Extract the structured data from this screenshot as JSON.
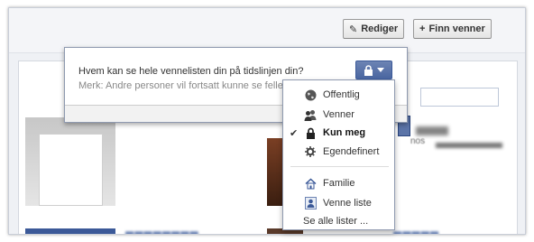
{
  "toolbar": {
    "edit_label": "Rediger",
    "edit_icon": "pencil-icon",
    "find_friends_label": "Finn venner",
    "find_friends_icon": "plus-icon"
  },
  "dialog": {
    "question": "Hvem kan se hele vennelisten din på tidslinjen din?",
    "note": "Merk: Andre personer vil fortsatt kunne se felle"
  },
  "privacy_menu": {
    "items": [
      {
        "label": "Offentlig",
        "icon": "globe-icon",
        "selected": false
      },
      {
        "label": "Venner",
        "icon": "friends-icon",
        "selected": false
      },
      {
        "label": "Kun meg",
        "icon": "lock-icon",
        "selected": true
      },
      {
        "label": "Egendefinert",
        "icon": "gear-icon",
        "selected": false
      }
    ],
    "lists": [
      {
        "label": "Familie",
        "icon": "house-icon"
      },
      {
        "label": "Venne liste",
        "icon": "person-list-icon"
      }
    ],
    "see_all": "Se alle lister ..."
  },
  "background": {
    "meta_text": "nos"
  },
  "colors": {
    "accent": "#3b5998",
    "button_blue": "#6d84b4",
    "page_bg": "#eff1f5"
  }
}
